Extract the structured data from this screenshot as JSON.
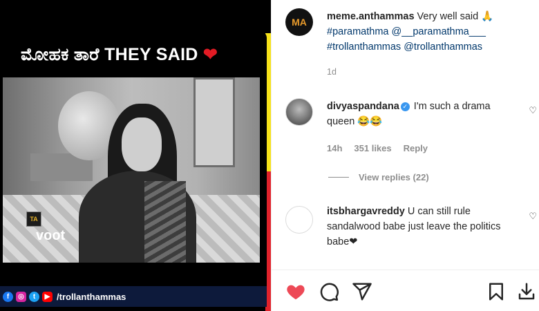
{
  "media": {
    "headline": "ಮೋಹಕ ತಾರೆ THEY SAID",
    "headline_heart": "❤",
    "watermark": "voot",
    "logo_text": "TA",
    "footer_handle": "/trollanthammas",
    "social_icons": [
      "facebook-icon",
      "instagram-icon",
      "twitter-icon",
      "youtube-icon"
    ]
  },
  "post": {
    "avatar_text": "MA",
    "username": "meme.anthammas",
    "caption": " Very well said 🙏",
    "tags": "#paramathma @__paramathma___ #trollanthammas @trollanthammas",
    "time": "1d"
  },
  "comments": [
    {
      "username": "divyaspandana",
      "verified": true,
      "text": " I'm such a drama queen 😂😂",
      "time": "14h",
      "likes": "351 likes",
      "reply": "Reply"
    },
    {
      "username": "itsbhargavreddy",
      "text": " U can still rule sandalwood babe just leave the politics babe❤"
    }
  ],
  "view_replies": "View replies (22)",
  "colors": {
    "like_red": "#ed4956",
    "accent_blue": "#3897f0",
    "stripe_yellow": "#f6e21a",
    "stripe_red": "#e0222b"
  }
}
